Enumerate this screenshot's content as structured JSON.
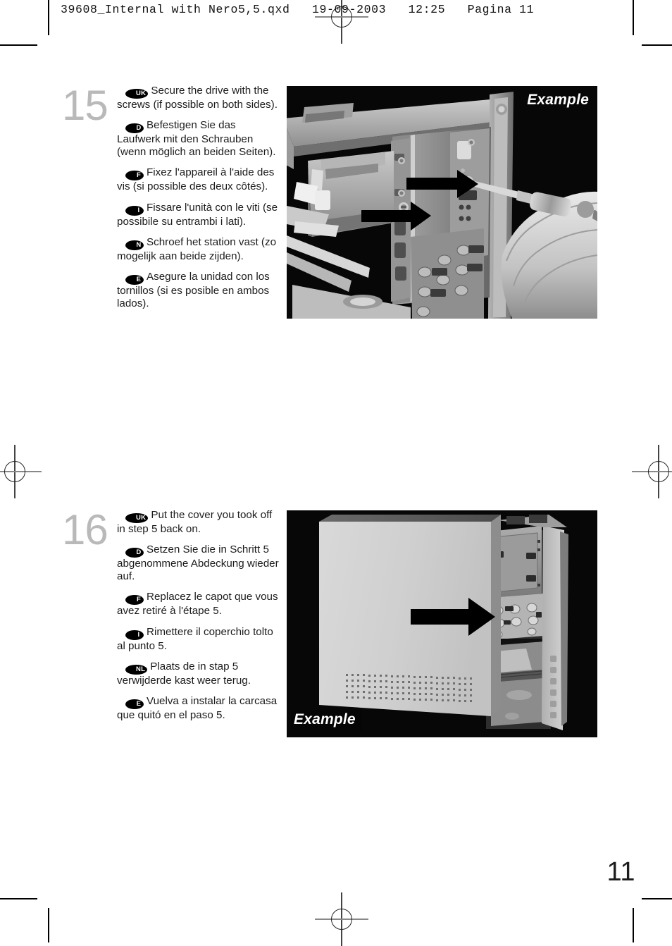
{
  "header": {
    "text": "39608_Internal with Nero5,5.qxd   19-09-2003   12:25   Pagina 11"
  },
  "page": {
    "number": "11"
  },
  "steps": [
    {
      "number": "15",
      "paragraphs": [
        {
          "lang": "UK",
          "text": "Secure the drive with the screws (if possible on both sides)."
        },
        {
          "lang": "D",
          "text": "Befestigen Sie das Laufwerk mit den Schrauben (wenn möglich an beiden Seiten)."
        },
        {
          "lang": "F",
          "text": "Fixez l'appareil à l'aide des vis (si possible des deux côtés)."
        },
        {
          "lang": "I",
          "text": "Fissare l'unità con le viti (se possibile su entrambi i lati)."
        },
        {
          "lang": "N",
          "text": "Schroef het station vast (zo mogelijk aan beide zijden)."
        },
        {
          "lang": "E",
          "text": "Asegure la unidad con los tornillos (si es posible en ambos lados)."
        }
      ],
      "photo": {
        "caption": "Example",
        "caption_position": "top-right",
        "description": "Open PC chassis with drive being screwed in place, two black arrows pointing to screw holes, hand holding screwdriver"
      }
    },
    {
      "number": "16",
      "paragraphs": [
        {
          "lang": "UK",
          "text": "Put the cover you took off in step 5 back on."
        },
        {
          "lang": "D",
          "text": "Setzen Sie die in Schritt 5 abgenommene Abdeckung wieder auf."
        },
        {
          "lang": "F",
          "text": "Replacez le capot que vous avez retiré à l'étape 5."
        },
        {
          "lang": "I",
          "text": "Rimettere il coperchio tolto al punto 5."
        },
        {
          "lang": "NL",
          "text": "Plaats de in stap 5 verwijderde kast weer terug."
        },
        {
          "lang": "E",
          "text": "Vuelva a instalar la carcasa que quitó en el paso 5."
        }
      ],
      "photo": {
        "caption": "Example",
        "caption_position": "bottom-left",
        "description": "PC tower side cover being slid back onto chassis, black arrow pointing right"
      }
    }
  ],
  "colors": {
    "step_number": "#b9b9b9",
    "text": "#1c1c1c",
    "badge_bg": "#000000",
    "badge_fg": "#ffffff",
    "photo_bg": "#000000"
  }
}
